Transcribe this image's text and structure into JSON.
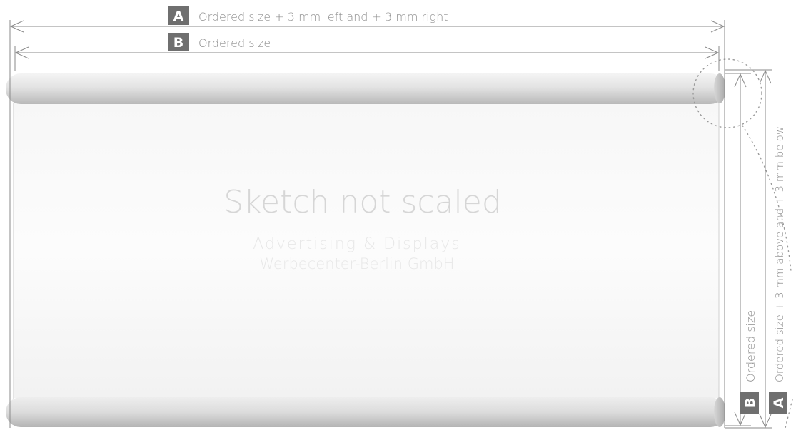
{
  "horizontal_dimensions": {
    "a": {
      "badge": "A",
      "label": "Ordered size + 3 mm left and + 3 mm right"
    },
    "b": {
      "badge": "B",
      "label": "Ordered size"
    }
  },
  "vertical_dimensions": {
    "a": {
      "badge": "A",
      "label": "Ordered size + 3 mm above and + 3 mm below"
    },
    "b": {
      "badge": "B",
      "label": "Ordered size"
    }
  },
  "center_text": {
    "title": "Sketch not scaled",
    "subtitle": "Advertising & Displays",
    "company": "Werbecenter-Berlin GmbH"
  },
  "colors": {
    "line": "#8a8a8a",
    "badge_bg": "#6f6f6f",
    "badge_fg": "#ffffff",
    "label": "#8e8e8e",
    "watermark": "#d6d6d6",
    "watermark_light": "#e8e8e8"
  }
}
